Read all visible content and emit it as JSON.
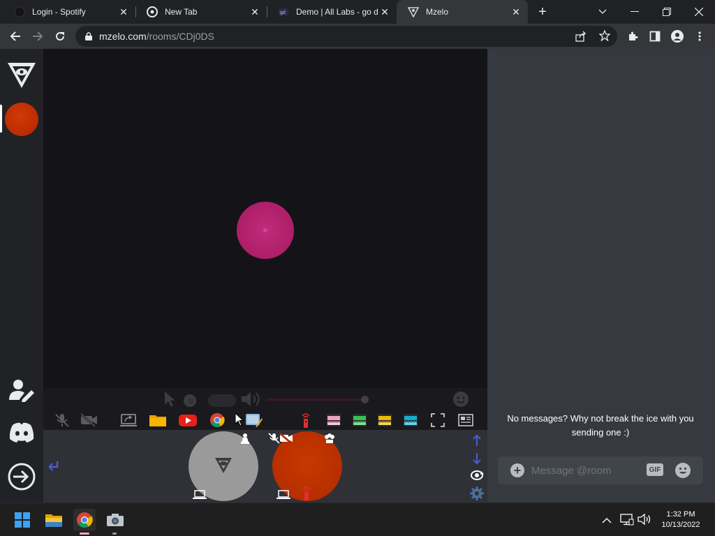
{
  "browser": {
    "tabs": [
      {
        "title": "Login - Spotify",
        "active": false
      },
      {
        "title": "New Tab",
        "active": false
      },
      {
        "title": "Demo | All Labs - go d",
        "active": false
      },
      {
        "title": "Mzelo",
        "active": true
      }
    ],
    "url_host": "mzelo.com",
    "url_path": "/rooms/CDj0DS"
  },
  "chat": {
    "empty_message": "No messages? Why not break the ice with you sending one :)",
    "input_placeholder": "Message @room",
    "gif_label": "GIF"
  },
  "taskbar": {
    "time": "1:32 PM",
    "date": "10/13/2022"
  },
  "colors": {
    "accent_magenta": "#b0206a",
    "user_red": "#c03000",
    "avatar_gray": "#9a9a9a",
    "stage_bg": "#141318",
    "chat_bg": "#36393f"
  }
}
